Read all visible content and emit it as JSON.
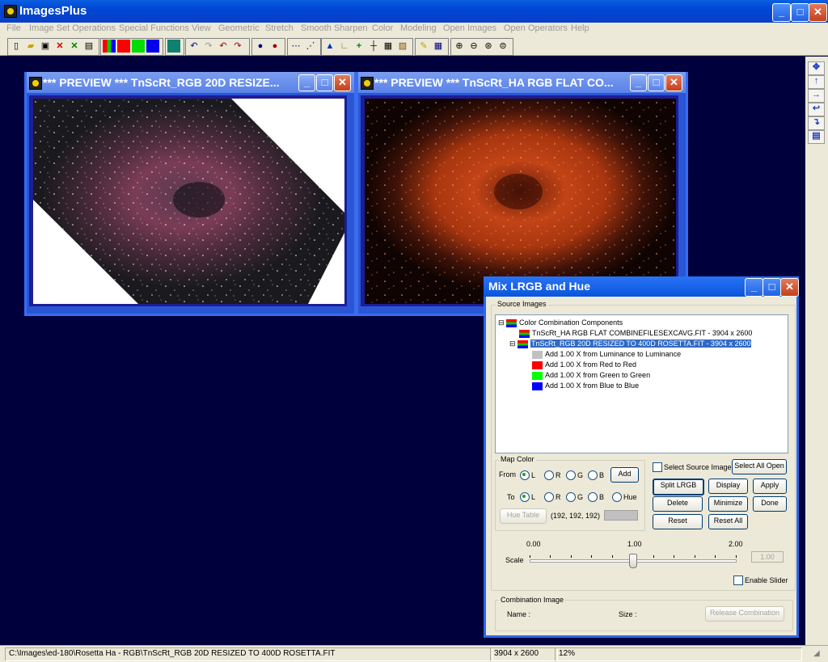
{
  "app": {
    "title": "ImagesPlus"
  },
  "menu": [
    "File",
    "Image Set Operations",
    "Special Functions",
    "View",
    "Geometric",
    "Stretch",
    "Smooth Sharpen",
    "Color",
    "Modeling",
    "Open Images",
    "Open Operators",
    "Help"
  ],
  "preview1": {
    "title": "*** PREVIEW *** TnScRt_RGB 20D RESIZE..."
  },
  "preview2": {
    "title": "*** PREVIEW *** TnScRt_HA RGB FLAT CO..."
  },
  "mix": {
    "title": "Mix LRGB and Hue",
    "source_group": "Source Images",
    "tree": {
      "root": "Color Combination Components",
      "item1": "TnScRt_HA RGB FLAT COMBINEFILESEXCAVG.FIT - 3904 x 2600",
      "item2": "TnScRt_RGB 20D RESIZED TO 400D ROSETTA.FIT - 3904 x 2600",
      "children": [
        {
          "label": "Add 1.00 X from Luminance to Luminance",
          "color": "#c0c0c0"
        },
        {
          "label": "Add 1.00 X from Red to Red",
          "color": "#ff0000"
        },
        {
          "label": "Add 1.00 X from Green to Green",
          "color": "#00ff00"
        },
        {
          "label": "Add 1.00 X from Blue to Blue",
          "color": "#0000ff"
        }
      ]
    },
    "map_color": "Map Color",
    "from_label": "From",
    "to_label": "To",
    "channels": [
      "L",
      "R",
      "G",
      "B"
    ],
    "hue": "Hue",
    "add_btn": "Add",
    "hue_table_btn": "Hue Table",
    "rgb_value": "(192, 192, 192)",
    "select_source": "Select Source Image",
    "buttons": {
      "select_all_open": "Select All Open",
      "split_lrgb": "Split LRGB",
      "display": "Display",
      "apply": "Apply",
      "delete": "Delete",
      "minimize": "Minimize",
      "done": "Done",
      "reset": "Reset",
      "reset_all": "Reset All",
      "release": "Release Combination"
    },
    "scale": {
      "label": "Scale",
      "min": "0.00",
      "mid": "1.00",
      "max": "2.00",
      "value": "1.00",
      "fraction": 0.5
    },
    "enable_slider": "Enable Slider",
    "combination_group": "Combination Image",
    "name_label": "Name :",
    "size_label": "Size :"
  },
  "status": {
    "path": "C:\\Images\\ed-180\\Rosetta Ha - RGB\\TnScRt_RGB 20D RESIZED TO 400D ROSETTA.FIT",
    "dims": "3904 x 2600",
    "zoom": "12%"
  },
  "colors": {
    "titlebar": "#0a4fd8",
    "workspace": "#00003d",
    "selection": "#316ac5"
  }
}
